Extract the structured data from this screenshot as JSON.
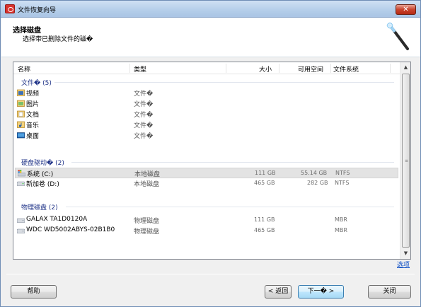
{
  "window": {
    "title": "文件恢复向导",
    "close_label": "✕"
  },
  "header": {
    "title": "选择磁盘",
    "subtitle": "选择带已删除文件的磁�"
  },
  "columns": {
    "name": "名称",
    "type": "类型",
    "size": "大小",
    "free": "可用空间",
    "fs": "文件系统"
  },
  "groups": {
    "folders": "文件� (5)",
    "drives": "硬盘驱动� (2)",
    "physical": "物理磁盘 (2)"
  },
  "folders": [
    {
      "name": "视频",
      "type": "文件�",
      "icon": "video-folder-icon"
    },
    {
      "name": "图片",
      "type": "文件�",
      "icon": "pictures-folder-icon"
    },
    {
      "name": "文档",
      "type": "文件�",
      "icon": "documents-folder-icon"
    },
    {
      "name": "音乐",
      "type": "文件�",
      "icon": "music-folder-icon"
    },
    {
      "name": "桌面",
      "type": "文件�",
      "icon": "desktop-folder-icon"
    }
  ],
  "drives": [
    {
      "name": "系统 (C:)",
      "type": "本地磁盘",
      "size": "111 GB",
      "free": "55.14 GB",
      "fs": "NTFS",
      "icon": "system-drive-icon"
    },
    {
      "name": "新加卷 (D:)",
      "type": "本地磁盘",
      "size": "465 GB",
      "free": "282 GB",
      "fs": "NTFS",
      "icon": "drive-icon"
    }
  ],
  "physical": [
    {
      "name": "GALAX TA1D0120A",
      "type": "物理磁盘",
      "size": "111 GB",
      "fs": "MBR",
      "icon": "disk-icon"
    },
    {
      "name": "WDC WD5002ABYS-02B1B0",
      "type": "物理磁盘",
      "size": "465 GB",
      "fs": "MBR",
      "icon": "disk-icon"
    }
  ],
  "options_link": "选项",
  "buttons": {
    "help": "帮助",
    "back": "< 返回",
    "next": "下一� >",
    "close": "关闭"
  },
  "colors": {
    "group_label": "#1e3287",
    "link": "#0b4dc5",
    "selected_row": "#e3e3e3"
  }
}
